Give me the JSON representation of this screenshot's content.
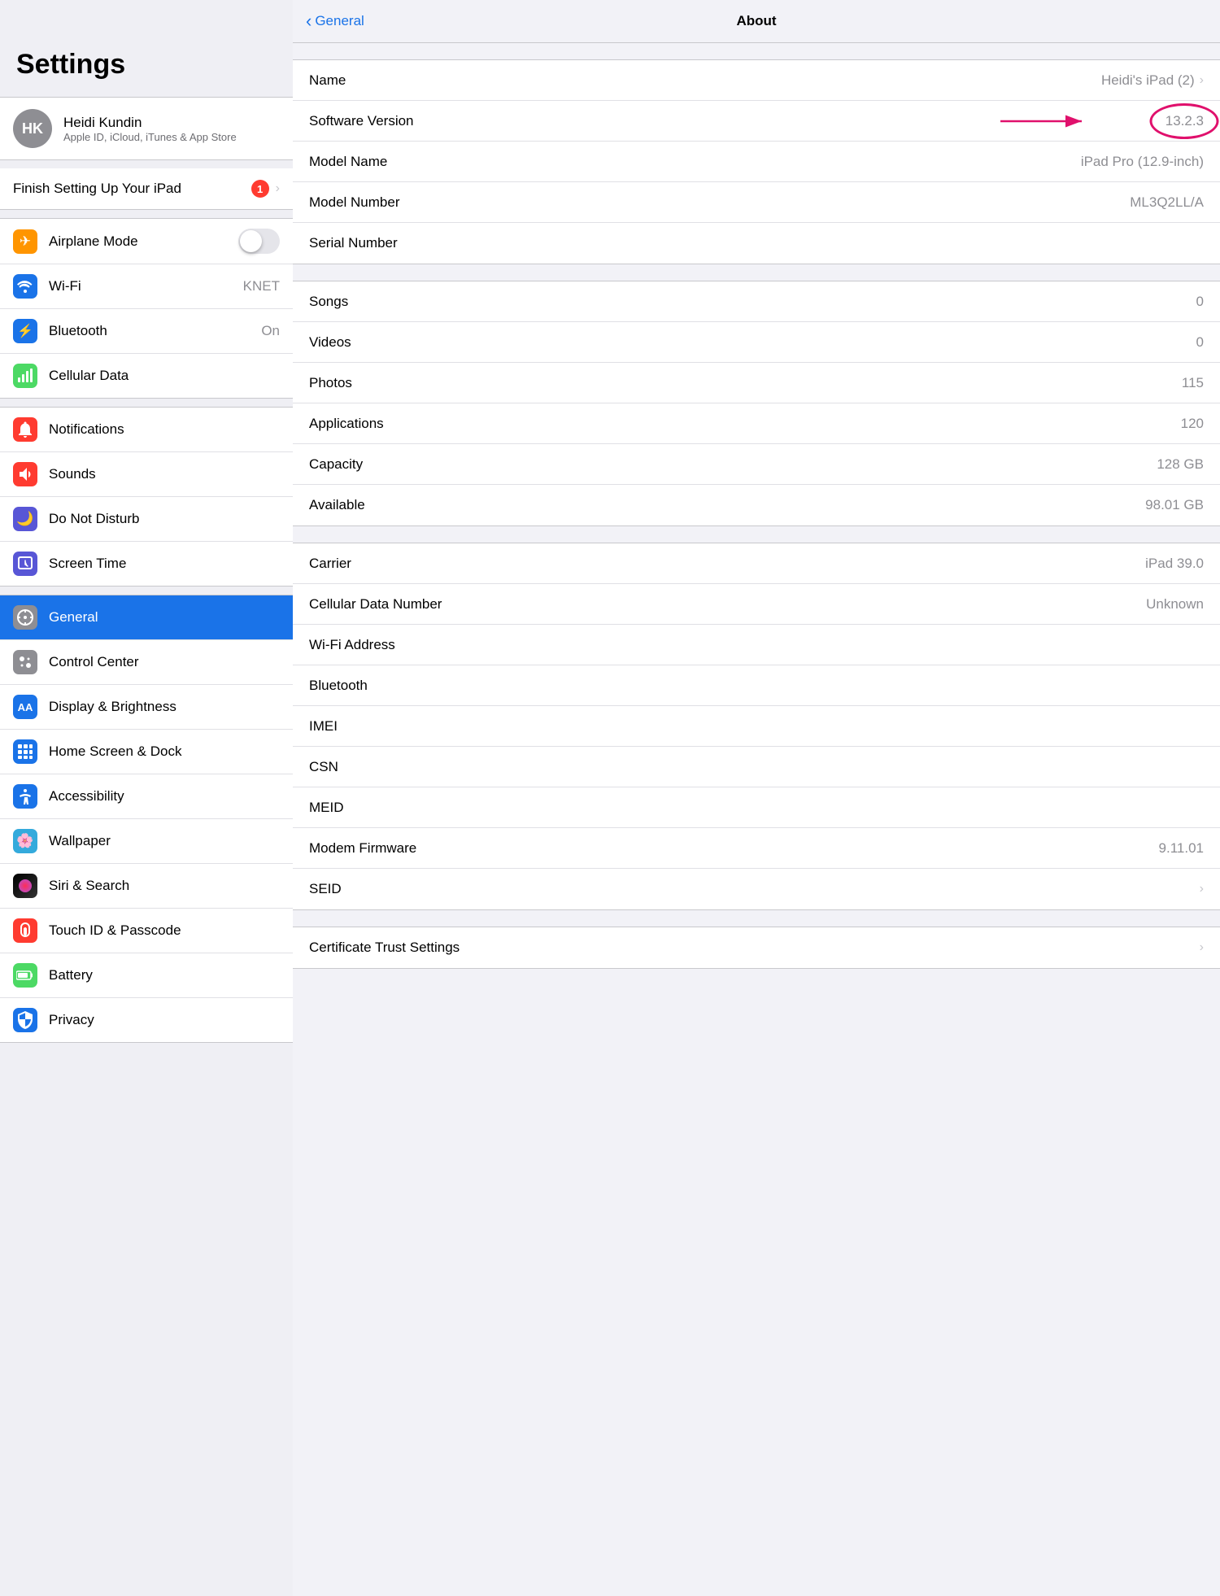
{
  "sidebar": {
    "title": "Settings",
    "user": {
      "initials": "HK",
      "name": "Heidi Kundin",
      "subtitle": "Apple ID, iCloud, iTunes & App Store"
    },
    "finish_setup": {
      "label": "Finish Setting Up Your iPad",
      "badge": "1"
    },
    "groups": [
      {
        "items": [
          {
            "id": "airplane-mode",
            "label": "Airplane Mode",
            "icon_bg": "#ff9500",
            "icon": "✈",
            "control": "toggle",
            "value": ""
          },
          {
            "id": "wifi",
            "label": "Wi-Fi",
            "icon_bg": "#1a73e8",
            "icon": "📶",
            "value": "KNET"
          },
          {
            "id": "bluetooth",
            "label": "Bluetooth",
            "icon_bg": "#1a73e8",
            "icon": "🔵",
            "value": "On"
          },
          {
            "id": "cellular",
            "label": "Cellular Data",
            "icon_bg": "#4cd964",
            "icon": "📡",
            "value": ""
          }
        ]
      },
      {
        "items": [
          {
            "id": "notifications",
            "label": "Notifications",
            "icon_bg": "#ff3b30",
            "icon": "🔔",
            "value": ""
          },
          {
            "id": "sounds",
            "label": "Sounds",
            "icon_bg": "#ff3b30",
            "icon": "🔊",
            "value": ""
          },
          {
            "id": "do-not-disturb",
            "label": "Do Not Disturb",
            "icon_bg": "#5856d6",
            "icon": "🌙",
            "value": ""
          },
          {
            "id": "screen-time",
            "label": "Screen Time",
            "icon_bg": "#5856d6",
            "icon": "⏱",
            "value": ""
          }
        ]
      },
      {
        "items": [
          {
            "id": "general",
            "label": "General",
            "icon_bg": "#8e8e93",
            "icon": "⚙️",
            "value": "",
            "active": true
          },
          {
            "id": "control-center",
            "label": "Control Center",
            "icon_bg": "#8e8e93",
            "icon": "🎛",
            "value": ""
          },
          {
            "id": "display-brightness",
            "label": "Display & Brightness",
            "icon_bg": "#1a73e8",
            "icon": "AA",
            "value": ""
          },
          {
            "id": "home-screen",
            "label": "Home Screen & Dock",
            "icon_bg": "#1a73e8",
            "icon": "⊞",
            "value": ""
          },
          {
            "id": "accessibility",
            "label": "Accessibility",
            "icon_bg": "#1a73e8",
            "icon": "♿",
            "value": ""
          },
          {
            "id": "wallpaper",
            "label": "Wallpaper",
            "icon_bg": "#34aadc",
            "icon": "🌸",
            "value": ""
          },
          {
            "id": "siri-search",
            "label": "Siri & Search",
            "icon_bg": "#000",
            "icon": "◉",
            "value": ""
          },
          {
            "id": "touch-id",
            "label": "Touch ID & Passcode",
            "icon_bg": "#ff3b30",
            "icon": "👆",
            "value": ""
          },
          {
            "id": "battery",
            "label": "Battery",
            "icon_bg": "#4cd964",
            "icon": "🔋",
            "value": ""
          },
          {
            "id": "privacy",
            "label": "Privacy",
            "icon_bg": "#1a73e8",
            "icon": "✋",
            "value": ""
          }
        ]
      }
    ]
  },
  "detail": {
    "nav_back": "General",
    "nav_title": "About",
    "groups": [
      {
        "rows": [
          {
            "id": "name",
            "label": "Name",
            "value": "Heidi's iPad (2)",
            "chevron": true
          },
          {
            "id": "software-version",
            "label": "Software Version",
            "value": "13.2.3",
            "annotated": true
          },
          {
            "id": "model-name",
            "label": "Model Name",
            "value": "iPad Pro (12.9-inch)",
            "chevron": false
          },
          {
            "id": "model-number",
            "label": "Model Number",
            "value": "ML3Q2LL/A",
            "chevron": false
          },
          {
            "id": "serial-number",
            "label": "Serial Number",
            "value": "",
            "chevron": false
          }
        ]
      },
      {
        "rows": [
          {
            "id": "songs",
            "label": "Songs",
            "value": "0"
          },
          {
            "id": "videos",
            "label": "Videos",
            "value": "0"
          },
          {
            "id": "photos",
            "label": "Photos",
            "value": "115"
          },
          {
            "id": "applications",
            "label": "Applications",
            "value": "120"
          },
          {
            "id": "capacity",
            "label": "Capacity",
            "value": "128 GB"
          },
          {
            "id": "available",
            "label": "Available",
            "value": "98.01 GB"
          }
        ]
      },
      {
        "rows": [
          {
            "id": "carrier",
            "label": "Carrier",
            "value": "iPad 39.0"
          },
          {
            "id": "cellular-data-number",
            "label": "Cellular Data Number",
            "value": "Unknown"
          },
          {
            "id": "wifi-address",
            "label": "Wi-Fi Address",
            "value": ""
          },
          {
            "id": "bluetooth-address",
            "label": "Bluetooth",
            "value": ""
          },
          {
            "id": "imei",
            "label": "IMEI",
            "value": ""
          },
          {
            "id": "csn",
            "label": "CSN",
            "value": ""
          },
          {
            "id": "meid",
            "label": "MEID",
            "value": ""
          },
          {
            "id": "modem-firmware",
            "label": "Modem Firmware",
            "value": "9.11.01"
          },
          {
            "id": "seid",
            "label": "SEID",
            "value": "",
            "chevron": true
          }
        ]
      },
      {
        "rows": [
          {
            "id": "certificate-trust",
            "label": "Certificate Trust Settings",
            "value": "",
            "chevron": true
          }
        ]
      }
    ]
  }
}
